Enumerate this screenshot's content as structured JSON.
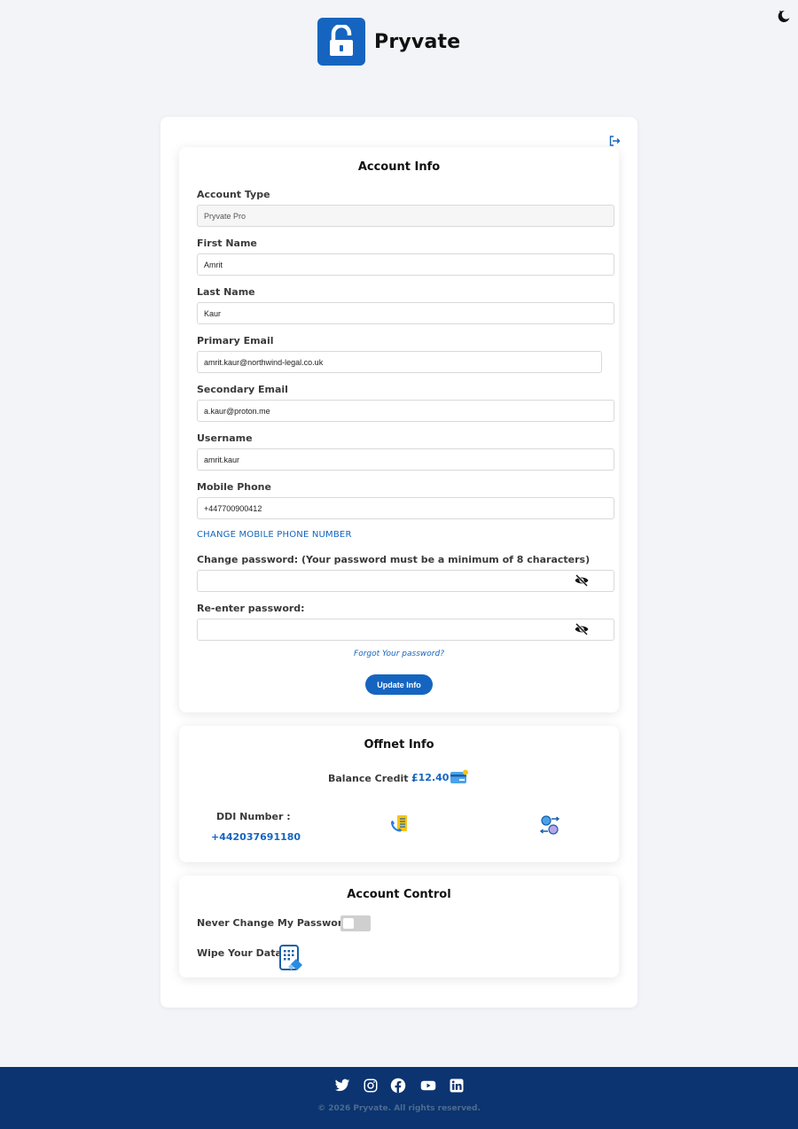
{
  "brand": {
    "name": "Pryvate",
    "accent": "#1565c0"
  },
  "icons": {
    "theme": "moon-icon",
    "logout": "logout-icon",
    "eye": "eye-slash-icon",
    "card": "credit-card-icon",
    "phone": "phone-forward-icon",
    "exchange": "currency-exchange-icon",
    "wipe": "wipe-data-icon"
  },
  "account_info": {
    "title": "Account Info",
    "account_type_label": "Account Type",
    "account_type_value": "Pryvate Pro",
    "first_name_label": "First Name",
    "first_name_value": "Amrit",
    "last_name_label": "Last Name",
    "last_name_value": "Kaur",
    "primary_email_label": "Primary Email",
    "primary_email_value": "amrit.kaur@northwind-legal.co.uk",
    "secondary_email_label": "Secondary Email",
    "secondary_email_value": "a.kaur@proton.me",
    "username_label": "Username",
    "username_value": "amrit.kaur",
    "mobile_label": "Mobile Phone",
    "mobile_value": "+447700900412",
    "change_mobile_link": "CHANGE MOBILE PHONE NUMBER",
    "change_password_label": "Change password: (Your password must be a minimum of 8 characters)",
    "reenter_password_label": "Re-enter password:",
    "forgot_link": "Forgot Your password?",
    "update_button": "Update Info"
  },
  "offnet_info": {
    "title": "Offnet Info",
    "balance_label": "Balance Credit :",
    "balance_value": "£12.40",
    "ddi_label": "DDI Number :",
    "ddi_value": "+442037691180"
  },
  "account_control": {
    "title": "Account Control",
    "never_change_label": "Never Change My Password :",
    "never_change_enabled": false,
    "wipe_label": "Wipe Your Data :"
  },
  "footer": {
    "social": [
      "twitter-icon",
      "instagram-icon",
      "facebook-icon",
      "youtube-icon",
      "linkedin-icon"
    ],
    "copyright": "© 2026 Pryvate. All rights reserved."
  }
}
